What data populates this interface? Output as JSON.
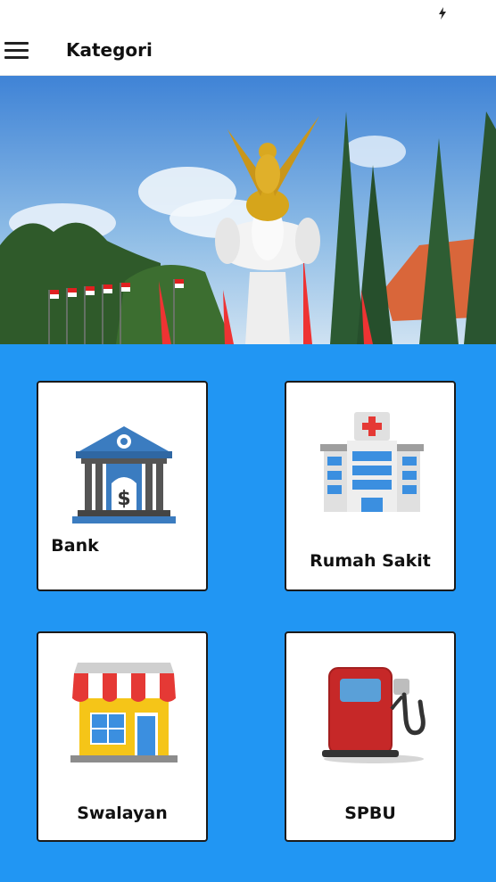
{
  "app_bar": {
    "title": "Kategori",
    "menu_icon": "hamburger-menu-icon"
  },
  "status_bar": {
    "icon": "lightning-bolt-icon"
  },
  "hero": {
    "image": "landscape-photo-garuda-monument-with-flags-and-pine-trees"
  },
  "colors": {
    "grid_background": "#2196f3",
    "card_background": "#ffffff",
    "bank_icon": "#3b7cc0",
    "hospital_cross": "#e53935",
    "fuel_pump": "#c62828"
  },
  "categories": [
    {
      "label": "Bank",
      "icon": "bank-icon"
    },
    {
      "label": "Rumah Sakit",
      "icon": "hospital-icon"
    },
    {
      "label": "Swalayan",
      "icon": "store-icon"
    },
    {
      "label": "SPBU",
      "icon": "fuel-pump-icon"
    }
  ]
}
